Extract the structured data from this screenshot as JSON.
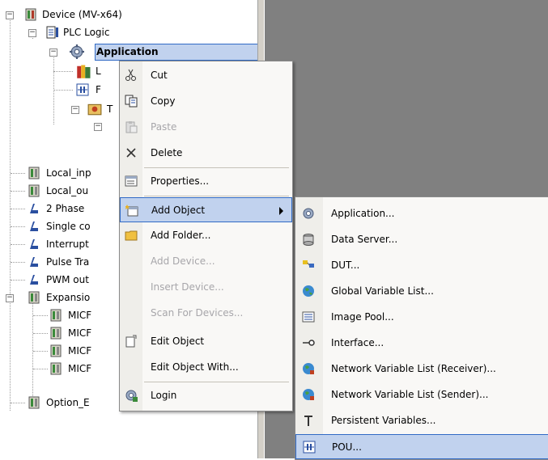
{
  "tree": {
    "items": [
      {
        "label": "Device (MV-x64)",
        "icon": "device-icon",
        "expander": "−"
      },
      {
        "label": "PLC Logic",
        "icon": "plc-logic-icon",
        "expander": "−"
      },
      {
        "label": "Application",
        "icon": "application-gear-icon",
        "expander": "−"
      },
      {
        "label": "L",
        "icon": "library-books-icon"
      },
      {
        "label": "F",
        "icon": "pou-icon"
      },
      {
        "label": "T",
        "icon": "task-config-icon",
        "expander": "−"
      },
      {
        "label": "",
        "icon": "task-icon",
        "expander": "−"
      },
      {
        "label": "Local_inp",
        "icon": "io-module-icon"
      },
      {
        "label": "Local_ou",
        "icon": "io-module-icon"
      },
      {
        "label": "2 Phase",
        "icon": "counter-icon"
      },
      {
        "label": "Single co",
        "icon": "counter-icon"
      },
      {
        "label": "Interrupt",
        "icon": "counter-icon"
      },
      {
        "label": "Pulse Tra",
        "icon": "counter-icon"
      },
      {
        "label": "PWM out",
        "icon": "counter-icon"
      },
      {
        "label": "Expansio",
        "icon": "io-module-icon",
        "expander": "−"
      },
      {
        "label": "MICF",
        "icon": "io-module-icon"
      },
      {
        "label": "MICF",
        "icon": "io-module-icon"
      },
      {
        "label": "MICF",
        "icon": "io-module-icon"
      },
      {
        "label": "MICF",
        "icon": "io-module-icon"
      },
      {
        "label": "Option_E",
        "icon": "io-module-icon"
      }
    ]
  },
  "context_menu": {
    "items": [
      {
        "label": "Cut",
        "icon": "scissors-icon",
        "enabled": true
      },
      {
        "label": "Copy",
        "icon": "copy-icon",
        "enabled": true
      },
      {
        "label": "Paste",
        "icon": "paste-icon",
        "enabled": false
      },
      {
        "label": "Delete",
        "icon": "delete-x-icon",
        "enabled": true
      },
      {
        "label": "Properties...",
        "icon": "properties-icon",
        "enabled": true
      },
      {
        "label": "Add Object",
        "icon": "add-object-icon",
        "enabled": true,
        "submenu": true
      },
      {
        "label": "Add Folder...",
        "icon": "folder-icon",
        "enabled": true
      },
      {
        "label": "Add Device...",
        "icon": "",
        "enabled": false
      },
      {
        "label": "Insert Device...",
        "icon": "",
        "enabled": false
      },
      {
        "label": "Scan For Devices...",
        "icon": "",
        "enabled": false
      },
      {
        "label": "Edit Object",
        "icon": "edit-object-icon",
        "enabled": true
      },
      {
        "label": "Edit Object With...",
        "icon": "",
        "enabled": true
      },
      {
        "label": "Login",
        "icon": "login-icon",
        "enabled": true
      }
    ]
  },
  "submenu": {
    "items": [
      {
        "label": "Application...",
        "icon": "application-gear-icon"
      },
      {
        "label": "Data Server...",
        "icon": "data-server-icon"
      },
      {
        "label": "DUT...",
        "icon": "dut-icon"
      },
      {
        "label": "Global Variable List...",
        "icon": "globe-icon"
      },
      {
        "label": "Image Pool...",
        "icon": "image-pool-icon"
      },
      {
        "label": "Interface...",
        "icon": "interface-icon"
      },
      {
        "label": "Network Variable List (Receiver)...",
        "icon": "network-globe-icon"
      },
      {
        "label": "Network Variable List (Sender)...",
        "icon": "network-globe-icon"
      },
      {
        "label": "Persistent Variables...",
        "icon": "persistent-variables-icon"
      },
      {
        "label": "POU...",
        "icon": "pou-icon"
      }
    ]
  },
  "colors": {
    "selection": "#c1d2ee",
    "selection_border": "#316ac5",
    "disabled_text": "#a7a6aa",
    "background_gray": "#808080"
  }
}
